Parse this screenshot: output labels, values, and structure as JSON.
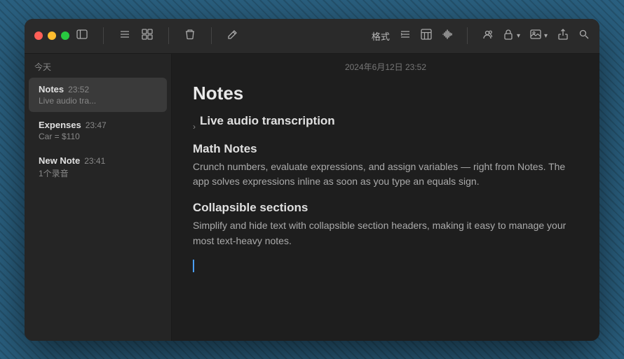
{
  "window": {
    "title": "Notes"
  },
  "toolbar": {
    "format_label": "格式",
    "list_label": "≡",
    "icons": {
      "sidebar": "sidebar-icon",
      "list": "list-icon",
      "grid": "grid-icon",
      "trash": "trash-icon",
      "edit": "edit-icon",
      "share": "share-icon",
      "search": "search-icon",
      "lock": "lock-icon",
      "image": "image-icon",
      "waveform": "waveform-icon",
      "collab": "collab-icon"
    }
  },
  "sidebar": {
    "section_label": "今天",
    "notes": [
      {
        "title": "Notes",
        "time": "23:52",
        "preview": "Live audio tra...",
        "active": true
      },
      {
        "title": "Expenses",
        "time": "23:47",
        "preview": "Car = $110",
        "active": false
      },
      {
        "title": "New Note",
        "time": "23:41",
        "preview": "1个录音",
        "active": false
      }
    ]
  },
  "content": {
    "header_date": "2024年6月12日 23:52",
    "main_title": "Notes",
    "live_audio_section": "Live audio transcription",
    "math_notes_title": "Math Notes",
    "math_notes_body": "Crunch numbers, evaluate expressions, and assign variables — right from Notes. The app solves expressions inline as soon as you type an equals sign.",
    "collapsible_title": "Collapsible sections",
    "collapsible_body": "Simplify and hide text with collapsible section headers, making it easy to manage your most text-heavy notes."
  }
}
